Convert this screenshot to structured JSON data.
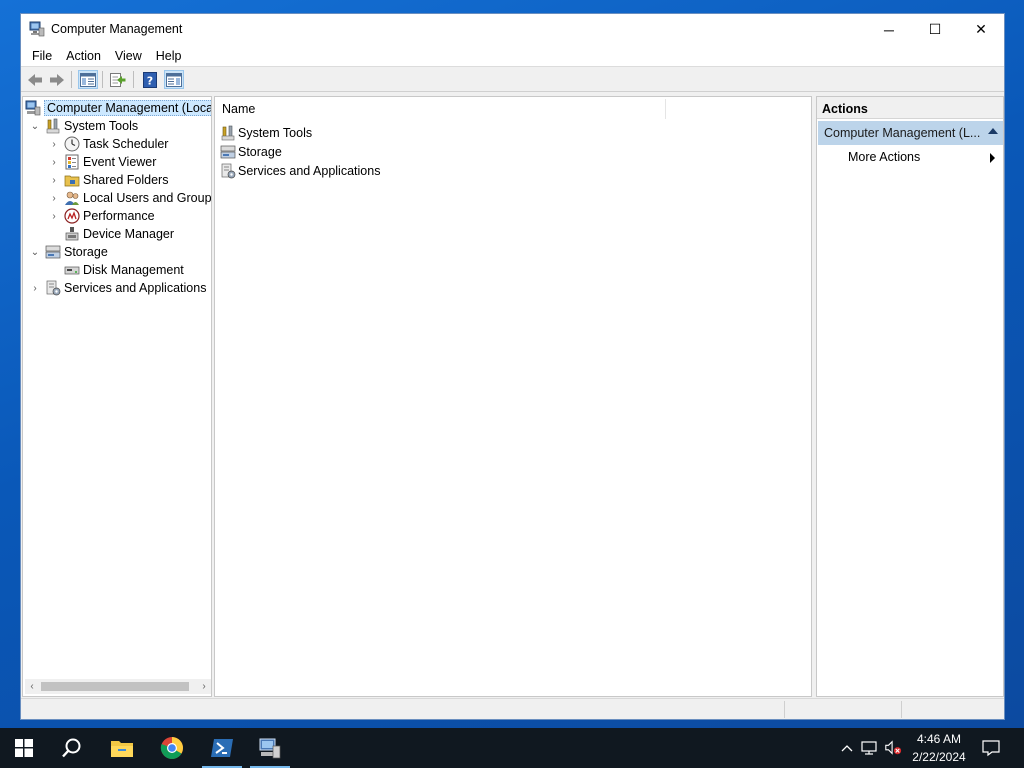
{
  "window": {
    "title": "Computer Management",
    "controls": {
      "minimize": "─",
      "maximize": "☐",
      "close": "✕"
    }
  },
  "menu": [
    "File",
    "Action",
    "View",
    "Help"
  ],
  "toolbar": {
    "buttons": [
      "back-icon",
      "forward-icon",
      "show-hide-console-tree-icon",
      "export-list-icon",
      "help-icon",
      "show-hide-action-pane-icon"
    ]
  },
  "tree": {
    "items": [
      {
        "label": "Computer Management (Local",
        "icon": "computer-management-icon",
        "level": 0,
        "expander": "",
        "selected": true
      },
      {
        "label": "System Tools",
        "icon": "system-tools-icon",
        "level": 1,
        "expander": "expanded"
      },
      {
        "label": "Task Scheduler",
        "icon": "clock-icon",
        "level": 2,
        "expander": "collapsed"
      },
      {
        "label": "Event Viewer",
        "icon": "event-viewer-icon",
        "level": 2,
        "expander": "collapsed"
      },
      {
        "label": "Shared Folders",
        "icon": "shared-folders-icon",
        "level": 2,
        "expander": "collapsed"
      },
      {
        "label": "Local Users and Groups",
        "icon": "users-icon",
        "level": 2,
        "expander": "collapsed"
      },
      {
        "label": "Performance",
        "icon": "performance-icon",
        "level": 2,
        "expander": "collapsed"
      },
      {
        "label": "Device Manager",
        "icon": "device-manager-icon",
        "level": 2,
        "expander": ""
      },
      {
        "label": "Storage",
        "icon": "storage-icon",
        "level": 1,
        "expander": "expanded"
      },
      {
        "label": "Disk Management",
        "icon": "disk-icon",
        "level": 2,
        "expander": ""
      },
      {
        "label": "Services and Applications",
        "icon": "services-icon",
        "level": 1,
        "expander": "collapsed"
      }
    ]
  },
  "list": {
    "column": "Name",
    "rows": [
      {
        "label": "System Tools",
        "icon": "system-tools-icon"
      },
      {
        "label": "Storage",
        "icon": "storage-icon"
      },
      {
        "label": "Services and Applications",
        "icon": "services-icon"
      }
    ]
  },
  "actions": {
    "header": "Actions",
    "section": "Computer Management (L...",
    "items": [
      "More Actions"
    ]
  },
  "taskbar": {
    "apps": [
      "windows-start-icon",
      "search-icon",
      "file-explorer-icon",
      "chrome-icon",
      "powershell-icon",
      "computer-management-icon"
    ],
    "tray": {
      "time": "4:46 AM",
      "date": "2/22/2024"
    }
  }
}
